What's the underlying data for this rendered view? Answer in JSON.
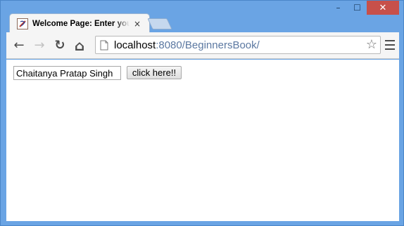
{
  "window": {
    "controls": {
      "minimize_glyph": "–",
      "maximize_glyph": "☐",
      "close_glyph": "✕",
      "close_color": "#c7504a"
    },
    "frame_color": "#6aa4e4"
  },
  "tab": {
    "title": "Welcome Page: Enter your",
    "close_glyph": "×",
    "favicon": "java-coffee-icon"
  },
  "toolbar": {
    "back_icon": "arrow-left-icon",
    "forward_icon": "arrow-right-icon",
    "reload_icon": "reload-icon",
    "home_icon": "home-icon",
    "back_glyph": "←",
    "forward_glyph": "→",
    "reload_glyph": "↻",
    "home_glyph": "⌂",
    "star_glyph": "☆",
    "menu_icon": "hamburger-menu-icon"
  },
  "address_bar": {
    "host": "localhost",
    "rest": ":8080/BeginnersBook/"
  },
  "form": {
    "name_value": "Chaitanya Pratap Singh",
    "button_label": "click here!!"
  }
}
